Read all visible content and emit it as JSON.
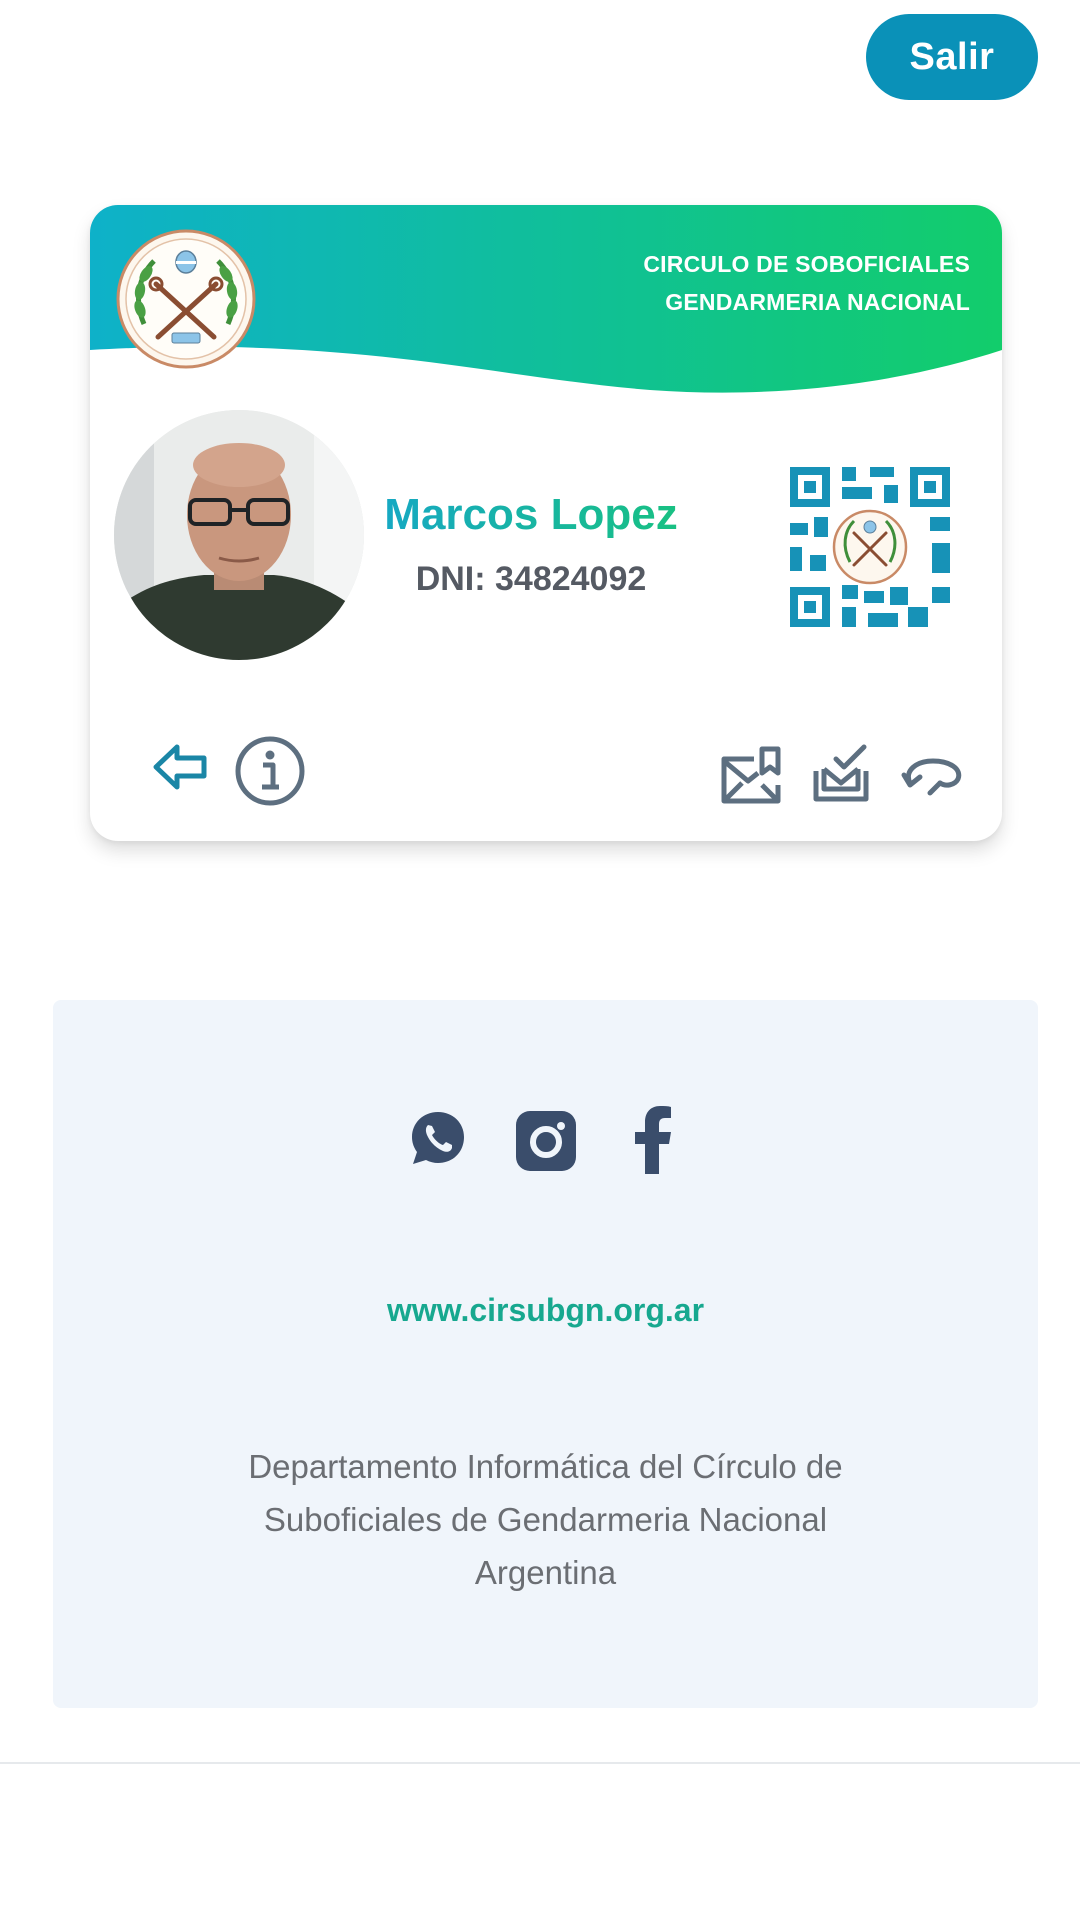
{
  "header": {
    "logout_label": "Salir"
  },
  "card": {
    "organization_line1": "CIRCULO DE SOBOFICIALES",
    "organization_line2": "GENDARMERIA NACIONAL",
    "member_name": "Marcos Lopez",
    "member_dni": "DNI: 34824092",
    "colors": {
      "gradient_start": "#0eb1c9",
      "gradient_end": "#12cd6b",
      "icon_teal": "#1a86a6",
      "icon_slate": "#5d6f80",
      "qr": "#1792b7"
    },
    "icons": {
      "left": [
        "back-arrow-icon",
        "info-icon"
      ],
      "right": [
        "mail-bookmark-icon",
        "stack-check-icon",
        "refresh-icon"
      ]
    }
  },
  "footer": {
    "social_icons": [
      "whatsapp-icon",
      "instagram-icon",
      "facebook-icon"
    ],
    "website": "www.cirsubgn.org.ar",
    "department_text": "Departamento Informática del Círculo de Suboficiales de Gendarmeria Nacional Argentina",
    "colors": {
      "panel_bg": "#f0f5fb",
      "social": "#3a4d6b",
      "website": "#17a88f"
    }
  }
}
